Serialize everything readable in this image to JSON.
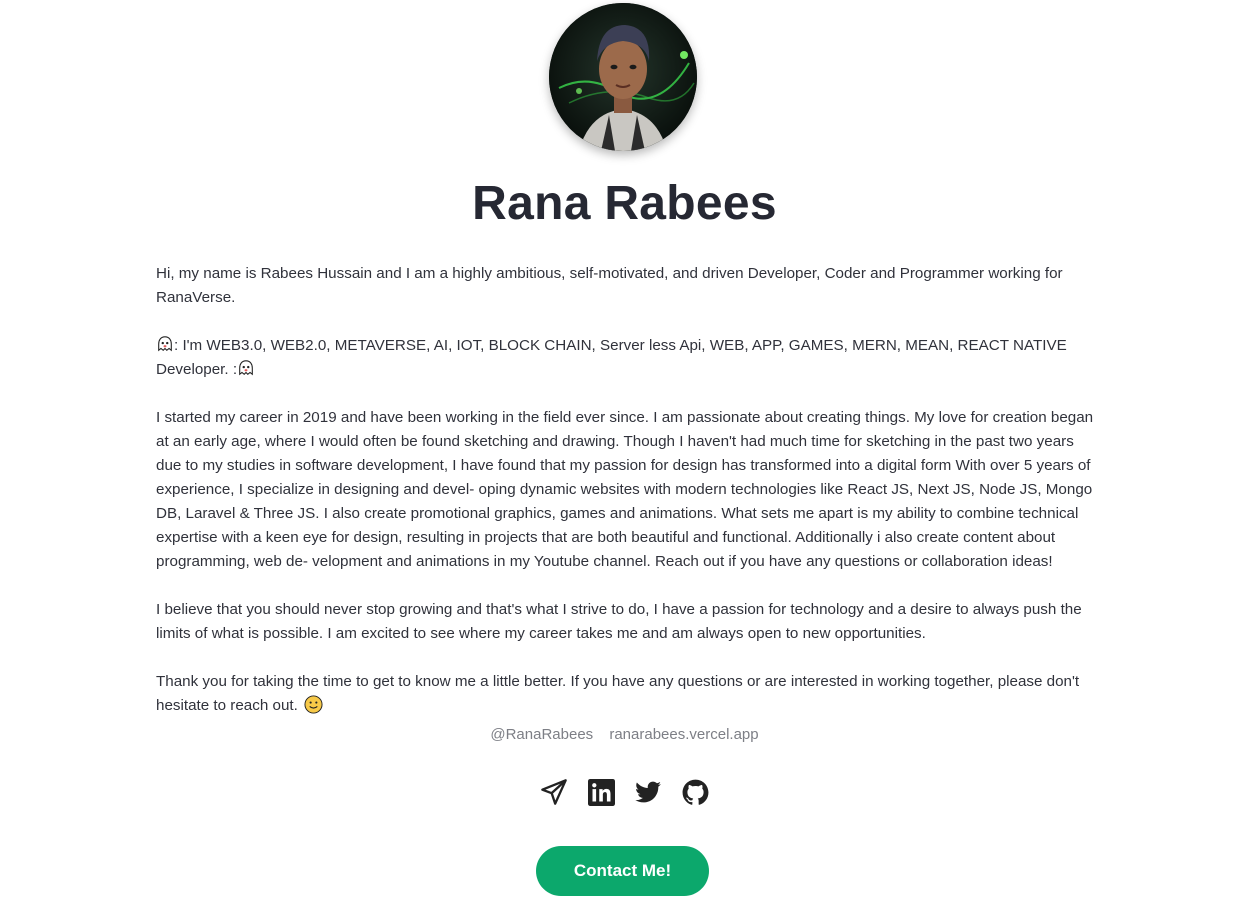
{
  "profile": {
    "name": "Rana Rabees",
    "avatar_alt": "profile-photo"
  },
  "bio": {
    "p1": "Hi, my name is Rabees Hussain and I am a highly ambitious, self-motivated, and driven Developer, Coder and Programmer working for RanaVerse.",
    "p2_text": ": I'm WEB3.0, WEB2.0, METAVERSE, AI, IOT, BLOCK CHAIN, Server less Api, WEB, APP, GAMES, MERN, MEAN, REACT NATIVE Developer. :",
    "p3": "I started my career in 2019 and have been working in the field ever since. I am passionate about creating things. My love for creation began at an early age, where I would often be found sketching and drawing. Though I haven't had much time for sketching in the past two years due to my studies in software development, I have found that my passion for design has transformed into a digital form With over 5 years of experience, I specialize in designing and devel- oping dynamic websites with modern technologies like React JS, Next JS, Node JS, Mongo DB, Laravel & Three JS. I also create promotional graphics, games and animations. What sets me apart is my ability to combine technical expertise with a keen eye for design, resulting in projects that are both beautiful and functional. Additionally i also create content about programming, web de- velopment and animations in my Youtube channel. Reach out if you have any questions or collaboration ideas!",
    "p4": "I believe that you should never stop growing and that's what I strive to do, I have a passion for technology and a desire to always push the limits of what is possible. I am excited to see where my career takes me and am always open to new opportunities.",
    "p5": "Thank you for taking the time to get to know me a little better. If you have any questions or are interested in working together, please don't hesitate to reach out."
  },
  "links": {
    "handle": "@RanaRabees",
    "website": "ranarabees.vercel.app"
  },
  "socials": [
    {
      "icon": "send-icon"
    },
    {
      "icon": "linkedin-icon"
    },
    {
      "icon": "twitter-icon"
    },
    {
      "icon": "github-icon"
    }
  ],
  "cta": {
    "label": "Contact Me!",
    "color": "#0ca86c"
  },
  "colors": {
    "text": "#30323b",
    "heading": "#262833",
    "muted": "#7d7f86",
    "icon": "#222222"
  }
}
